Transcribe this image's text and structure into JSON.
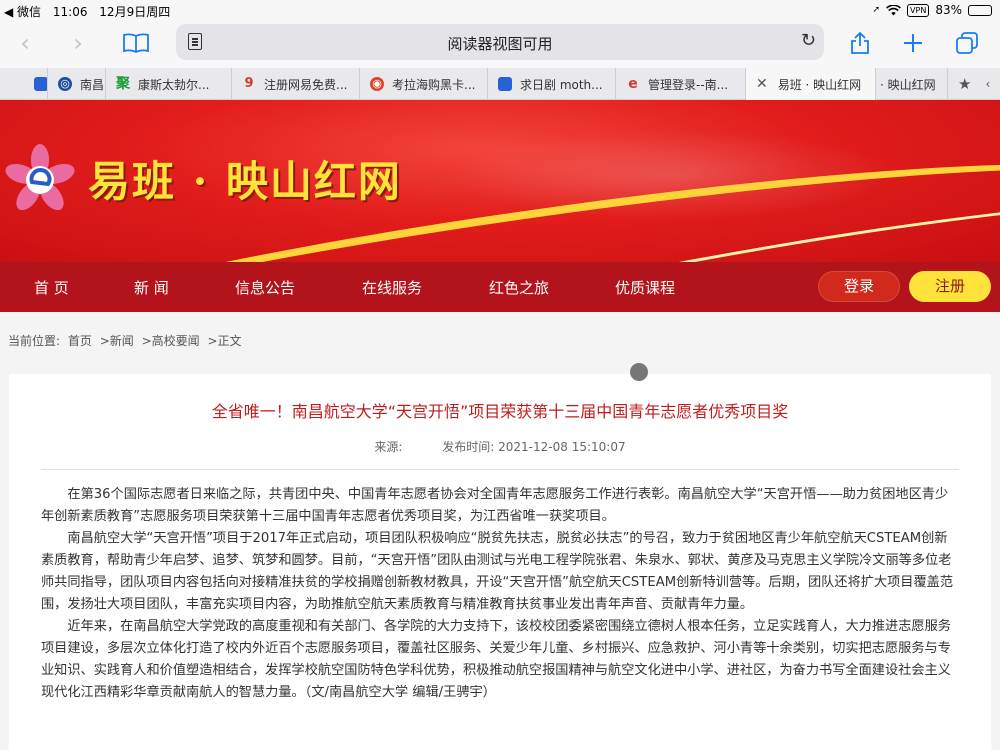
{
  "status_bar": {
    "carrier": "◀ 微信",
    "time": "11:06",
    "date": "12月9日周四",
    "vpn": "VPN",
    "battery_text": "83%",
    "battery_level": 0.83
  },
  "toolbar": {
    "address_text": "阅读器视图可用"
  },
  "tabs": [
    {
      "label": "",
      "color": "#2b5fd9",
      "icon": "paw"
    },
    {
      "label": "南昌",
      "color": "#1f4e9c",
      "icon": "badge"
    },
    {
      "label": "康斯太勃尔...",
      "color": "#1a9b3a",
      "icon": "ju"
    },
    {
      "label": "注册网易免费...",
      "color": "#d43b2a",
      "icon": "logo"
    },
    {
      "label": "考拉海购黑卡...",
      "color": "#e0432d",
      "icon": "weibo"
    },
    {
      "label": "求日剧 moth...",
      "color": "#2b5fd9",
      "icon": "paw"
    },
    {
      "label": "管理登录--南...",
      "color": "#d43b2a",
      "icon": "e"
    },
    {
      "label": "易班 · 映山红网",
      "color": "#555555",
      "icon": "close"
    },
    {
      "label": "· 映山红网",
      "color": "#555555",
      "icon": "none"
    },
    {
      "label": "",
      "color": "#555555",
      "icon": "star"
    }
  ],
  "site": {
    "title": "易班 · 映山红网"
  },
  "nav": {
    "items": [
      "首 页",
      "新 闻",
      "信息公告",
      "在线服务",
      "红色之旅",
      "优质课程"
    ],
    "login": "登录",
    "register": "注册"
  },
  "breadcrumb": {
    "label": "当前位置:",
    "items": [
      "首页",
      ">新闻",
      ">高校要闻",
      ">正文"
    ]
  },
  "article": {
    "title": "全省唯一！南昌航空大学“天宫开悟”项目荣获第十三届中国青年志愿者优秀项目奖",
    "source_label": "来源:",
    "publish_label": "发布时间: 2021-12-08 15:10:07",
    "paragraphs": [
      "在第36个国际志愿者日来临之际，共青团中央、中国青年志愿者协会对全国青年志愿服务工作进行表彰。南昌航空大学“天宫开悟——助力贫困地区青少年创新素质教育”志愿服务项目荣获第十三届中国青年志愿者优秀项目奖，为江西省唯一获奖项目。",
      "南昌航空大学“天宫开悟”项目于2017年正式启动，项目团队积极响应“脱贫先扶志，脱贫必扶志”的号召，致力于贫困地区青少年航空航天CSTEAM创新素质教育，帮助青少年启梦、追梦、筑梦和圆梦。目前，“天宫开悟”团队由测试与光电工程学院张君、朱泉水、郭状、黄彦及马克思主义学院冷文丽等多位老师共同指导，团队项目内容包括向对接精准扶贫的学校捐赠创新教材教具，开设“天宫开悟”航空航天CSTEAM创新特训营等。后期，团队还将扩大项目覆盖范围，发扬壮大项目团队，丰富充实项目内容，为助推航空航天素质教育与精准教育扶贫事业发出青年声音、贡献青年力量。",
      "近年来，在南昌航空大学党政的高度重视和有关部门、各学院的大力支持下，该校校团委紧密围绕立德树人根本任务，立足实践育人，大力推进志愿服务项目建设，多层次立体化打造了校内外近百个志愿服务项目，覆盖社区服务、关爱少年儿童、乡村振兴、应急救护、河小青等十余类别，切实把志愿服务与专业知识、实践育人和价值塑造相结合，发挥学校航空国防特色学科优势，积极推动航空报国精神与航空文化进中小学、进社区，为奋力书写全面建设社会主义现代化江西精彩华章贡献南航人的智慧力量。（文/南昌航空大学    编辑/王骋宇）"
    ]
  },
  "colors": {
    "banner_red": "#e21d1c",
    "nav_red": "#b3131a",
    "title_yellow": "#ffe23a",
    "headline_red": "#c11c1c",
    "ios_blue": "#1a7cf5"
  }
}
